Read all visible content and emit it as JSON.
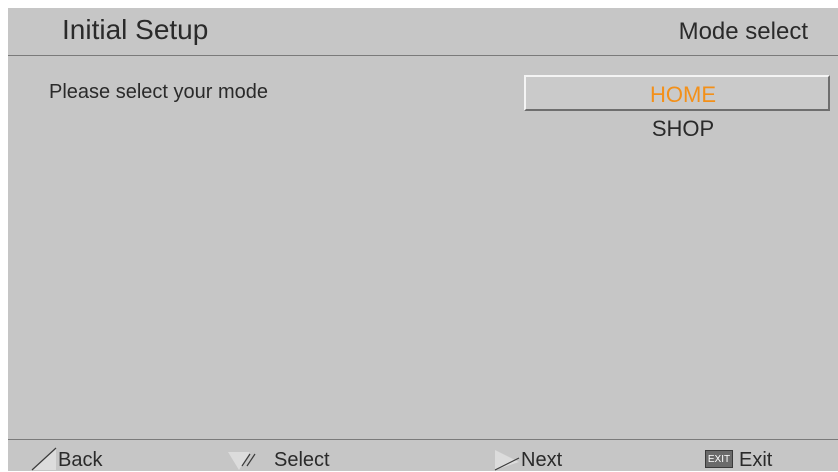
{
  "header": {
    "title": "Initial Setup",
    "subtitle": "Mode select"
  },
  "main": {
    "prompt": "Please select your mode",
    "options": [
      {
        "label": "HOME",
        "selected": true
      },
      {
        "label": "SHOP",
        "selected": false
      }
    ],
    "highlight_color": "#f39019"
  },
  "footer": {
    "back_label": "Back",
    "select_label": "Select",
    "next_label": "Next",
    "exit_key": "EXIT",
    "exit_label": "Exit",
    "icons": [
      "left-arrow-icon",
      "select-icon",
      "right-arrow-icon",
      "exit-key-icon"
    ]
  }
}
